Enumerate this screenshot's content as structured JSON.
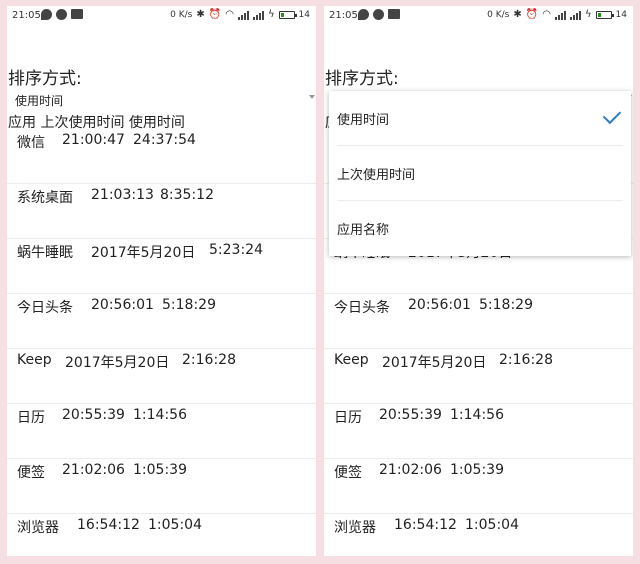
{
  "status_bar": {
    "time": "21:05",
    "net_speed": "0 K/s",
    "battery_level": "14"
  },
  "sort_title": "排序方式:",
  "spinner": {
    "selected": "使用时间"
  },
  "column_headers": "应用 上次使用时间 使用时间",
  "apps": [
    {
      "name": "微信",
      "last_used": "21:00:47",
      "duration": "24:37:54"
    },
    {
      "name": "系统桌面",
      "last_used": "21:03:13",
      "duration": "8:35:12"
    },
    {
      "name": "蜗牛睡眠",
      "last_used": "2017年5月20日",
      "duration": "5:23:24"
    },
    {
      "name": "今日头条",
      "last_used": "20:56:01",
      "duration": "5:18:29"
    },
    {
      "name": "Keep",
      "last_used": "2017年5月20日",
      "duration": "2:16:28"
    },
    {
      "name": "日历",
      "last_used": "20:55:39",
      "duration": "1:14:56"
    },
    {
      "name": "便签",
      "last_used": "21:02:06",
      "duration": "1:05:39"
    },
    {
      "name": "浏览器",
      "last_used": "16:54:12",
      "duration": "1:05:04"
    }
  ],
  "dropdown": {
    "options": [
      "使用时间",
      "上次使用时间",
      "应用名称"
    ],
    "selected_index": 0
  },
  "colors": {
    "background": "#f6dfe2",
    "check_accent": "#2d7ec7"
  }
}
